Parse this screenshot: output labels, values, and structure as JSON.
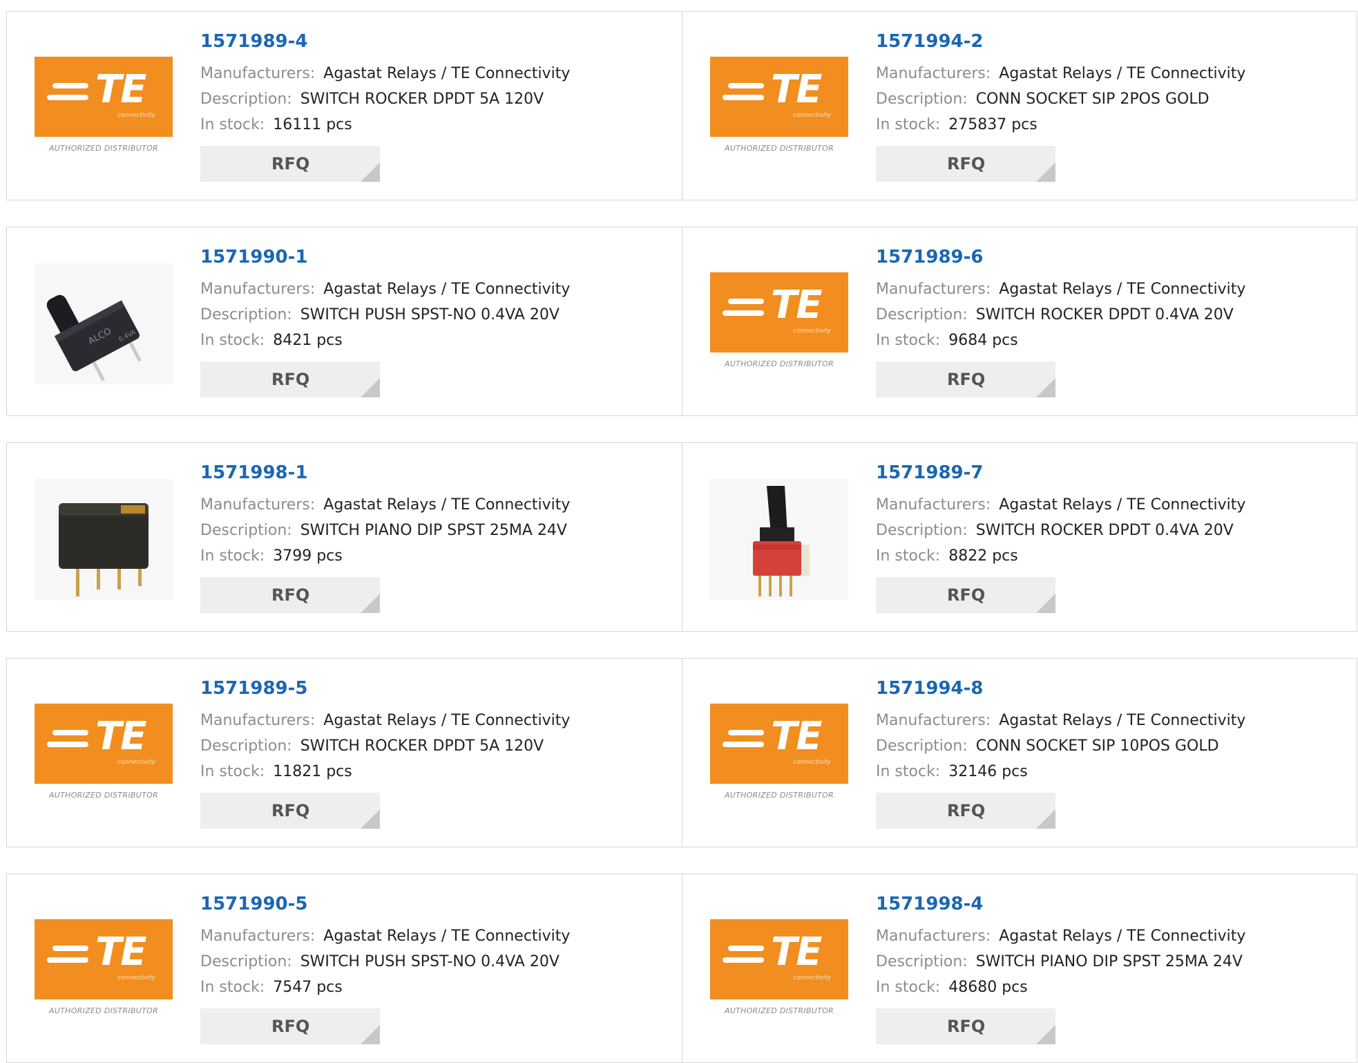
{
  "labels": {
    "manufacturers": "Manufacturers:",
    "description": "Description:",
    "in_stock": "In stock:",
    "rfq": "RFQ"
  },
  "logo": {
    "brand": "TE",
    "sub": "connectivity",
    "authorized": "AUTHORIZED DISTRIBUTOR",
    "color": "#f28d1f"
  },
  "products": [
    {
      "part": "1571989-4",
      "manufacturer": "Agastat Relays / TE Connectivity",
      "description": "SWITCH ROCKER DPDT 5A 120V",
      "stock": "16111 pcs",
      "image": "te-logo"
    },
    {
      "part": "1571994-2",
      "manufacturer": "Agastat Relays / TE Connectivity",
      "description": "CONN SOCKET SIP 2POS GOLD",
      "stock": "275837 pcs",
      "image": "te-logo"
    },
    {
      "part": "1571990-1",
      "manufacturer": "Agastat Relays / TE Connectivity",
      "description": "SWITCH PUSH SPST-NO 0.4VA 20V",
      "stock": "8421 pcs",
      "image": "pushbutton-photo"
    },
    {
      "part": "1571989-6",
      "manufacturer": "Agastat Relays / TE Connectivity",
      "description": "SWITCH ROCKER DPDT 0.4VA 20V",
      "stock": "9684 pcs",
      "image": "te-logo"
    },
    {
      "part": "1571998-1",
      "manufacturer": "Agastat Relays / TE Connectivity",
      "description": "SWITCH PIANO DIP SPST 25MA 24V",
      "stock": "3799 pcs",
      "image": "dip-switch-photo"
    },
    {
      "part": "1571989-7",
      "manufacturer": "Agastat Relays / TE Connectivity",
      "description": "SWITCH ROCKER DPDT 0.4VA 20V",
      "stock": "8822 pcs",
      "image": "rocker-switch-photo"
    },
    {
      "part": "1571989-5",
      "manufacturer": "Agastat Relays / TE Connectivity",
      "description": "SWITCH ROCKER DPDT 5A 120V",
      "stock": "11821 pcs",
      "image": "te-logo"
    },
    {
      "part": "1571994-8",
      "manufacturer": "Agastat Relays / TE Connectivity",
      "description": "CONN SOCKET SIP 10POS GOLD",
      "stock": "32146 pcs",
      "image": "te-logo"
    },
    {
      "part": "1571990-5",
      "manufacturer": "Agastat Relays / TE Connectivity",
      "description": "SWITCH PUSH SPST-NO 0.4VA 20V",
      "stock": "7547 pcs",
      "image": "te-logo"
    },
    {
      "part": "1571998-4",
      "manufacturer": "Agastat Relays / TE Connectivity",
      "description": "SWITCH PIANO DIP SPST 25MA 24V",
      "stock": "48680 pcs",
      "image": "te-logo"
    }
  ]
}
